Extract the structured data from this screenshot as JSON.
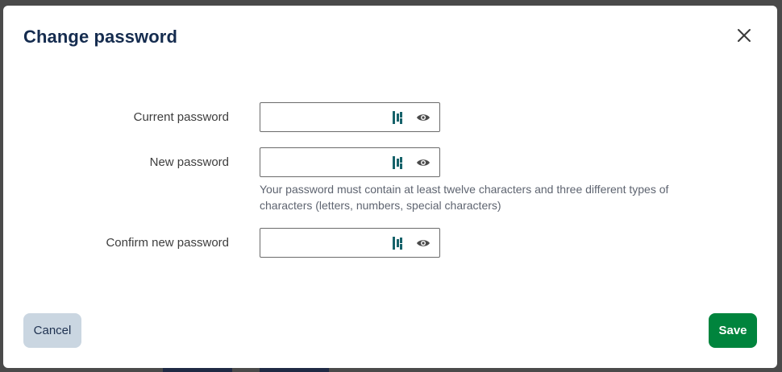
{
  "dialog": {
    "title": "Change password",
    "close_icon": "close-icon"
  },
  "fields": [
    {
      "label": "Current password",
      "value": "",
      "pm_icon": "password-manager-icon",
      "toggle_icon": "eye-icon"
    },
    {
      "label": "New password",
      "value": "",
      "pm_icon": "password-manager-icon",
      "toggle_icon": "eye-icon"
    },
    {
      "label": "Confirm new password",
      "value": "",
      "pm_icon": "password-manager-icon",
      "toggle_icon": "eye-icon"
    }
  ],
  "hint": "Your password must contain at least twelve characters and three different types of characters (letters, numbers, special characters)",
  "actions": {
    "cancel_label": "Cancel",
    "save_label": "Save"
  },
  "colors": {
    "title": "#152c4f",
    "save_bg": "#00843d",
    "cancel_bg": "#cad6e1",
    "icon_accent": "#16626a"
  }
}
